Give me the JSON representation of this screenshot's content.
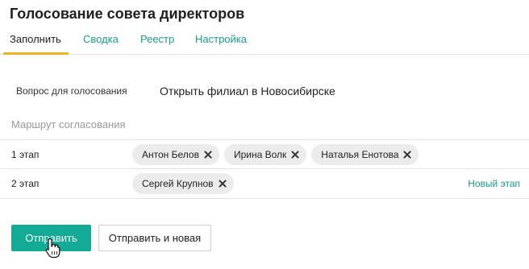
{
  "title": "Голосование совета директоров",
  "tabs": [
    {
      "label": "Заполнить"
    },
    {
      "label": "Сводка"
    },
    {
      "label": "Реестр"
    },
    {
      "label": "Настройка"
    }
  ],
  "question": {
    "label": "Вопрос для голосования",
    "value": "Открыть филиал в Новосибирске"
  },
  "route": {
    "title": "Маршрут согласования",
    "stages": [
      {
        "label": "1 этап",
        "members": [
          "Антон Белов",
          "Ирина Волк",
          "Наталья Енотова"
        ]
      },
      {
        "label": "2 этап",
        "members": [
          "Сергей Крупнов"
        ]
      }
    ],
    "new_stage_label": "Новый этап"
  },
  "actions": {
    "submit_label": "Отправить",
    "submit_new_label": "Отправить и новая"
  },
  "colors": {
    "accent": "#13ab96",
    "link": "#1a9c8c",
    "tab_underline": "#e8b51e"
  },
  "icons": {
    "remove": "close-icon",
    "cursor": "hand-pointer-icon"
  }
}
